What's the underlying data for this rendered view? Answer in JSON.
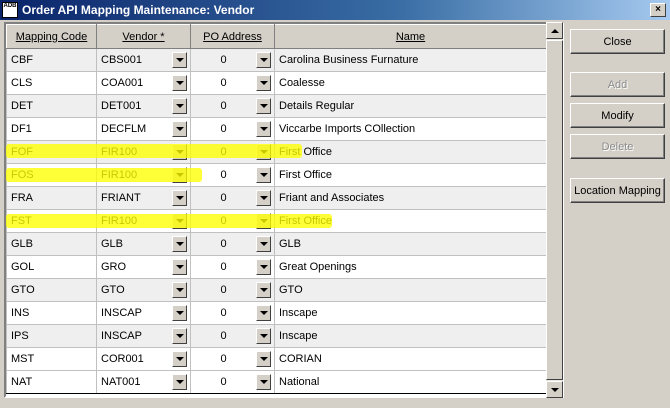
{
  "window": {
    "icon_text": "ADB",
    "title": "Order API Mapping Maintenance: Vendor",
    "close_glyph": "×"
  },
  "grid": {
    "columns": [
      "Mapping Code",
      "Vendor *",
      "PO Address",
      "Name"
    ],
    "rows": [
      {
        "code": "CBF",
        "vendor": "CBS001",
        "po": "0",
        "name": "Carolina Business Furnature"
      },
      {
        "code": "CLS",
        "vendor": "COA001",
        "po": "0",
        "name": "Coalesse"
      },
      {
        "code": "DET",
        "vendor": "DET001",
        "po": "0",
        "name": "Details Regular"
      },
      {
        "code": "DF1",
        "vendor": "DECFLM",
        "po": "0",
        "name": "Viccarbe Imports COllection"
      },
      {
        "code": "FOF",
        "vendor": "FIR100",
        "po": "0",
        "name": "First Office"
      },
      {
        "code": "FOS",
        "vendor": "FIR100",
        "po": "0",
        "name": "First Office"
      },
      {
        "code": "FRA",
        "vendor": "FRIANT",
        "po": "0",
        "name": "Friant and Associates"
      },
      {
        "code": "FST",
        "vendor": "FIR100",
        "po": "0",
        "name": "First Office"
      },
      {
        "code": "GLB",
        "vendor": "GLB",
        "po": "0",
        "name": "GLB"
      },
      {
        "code": "GOL",
        "vendor": "GRO",
        "po": "0",
        "name": "Great Openings"
      },
      {
        "code": "GTO",
        "vendor": "GTO",
        "po": "0",
        "name": "GTO"
      },
      {
        "code": "INS",
        "vendor": "INSCAP",
        "po": "0",
        "name": "Inscape"
      },
      {
        "code": "IPS",
        "vendor": "INSCAP",
        "po": "0",
        "name": "Inscape"
      },
      {
        "code": "MST",
        "vendor": "COR001",
        "po": "0",
        "name": "CORIAN"
      },
      {
        "code": "NAT",
        "vendor": "NAT001",
        "po": "0",
        "name": "National"
      }
    ]
  },
  "buttons": {
    "close": "Close",
    "add": "Add",
    "modify": "Modify",
    "delete": "Delete",
    "location_mapping": "Location Mapping"
  },
  "colors": {
    "highlight": "#ffff00",
    "titlebar": "#0a246a",
    "face": "#d4d0c8"
  }
}
